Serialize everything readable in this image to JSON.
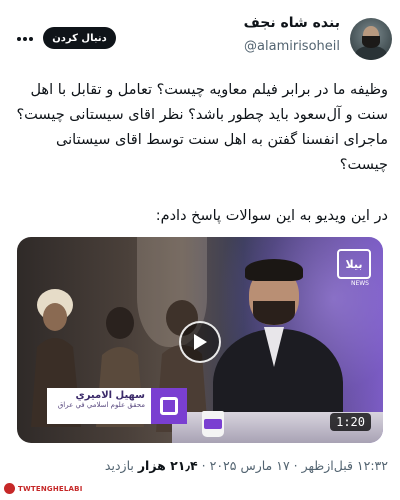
{
  "author": {
    "display_name": "بنده شاه نجف",
    "handle": "@alamirisoheil"
  },
  "follow_button": "دنبال کردن",
  "tweet": {
    "text": "وظیفه ما در برابر فیلم معاویه چیست؟ تعامل و تقابل با اهل سنت و آل‌سعود باید چطور باشد؟ نظر اقای سیستانی چیست؟ ماجرای انفسنا گفتن به اهل سنت توسط اقای سیستانی چیست؟",
    "intro": "در این ویدیو به این سوالات پاسخ دادم:"
  },
  "video": {
    "duration": "1:20",
    "channel_logo": "بيلا",
    "channel_sub": "NEWS",
    "lower_third_name": "سهيل الاميري",
    "lower_third_role": "محقق علوم اسلامي في عراق"
  },
  "meta": {
    "time": "۱۲:۳۲ قبل‌ازظهر",
    "date": "۱۷ مارس ۲۰۲۵",
    "views_count": "۲۱٫۴ هزار",
    "views_label": "بازدید"
  },
  "watermark": "TWTENGHELABI",
  "icons": {
    "more": "more-horizontal-icon",
    "play": "play-icon"
  },
  "colors": {
    "follow_bg": "#0f1419",
    "secondary_text": "#536471",
    "accent_purple": "#7a3fd1",
    "watermark_red": "#c62828"
  }
}
